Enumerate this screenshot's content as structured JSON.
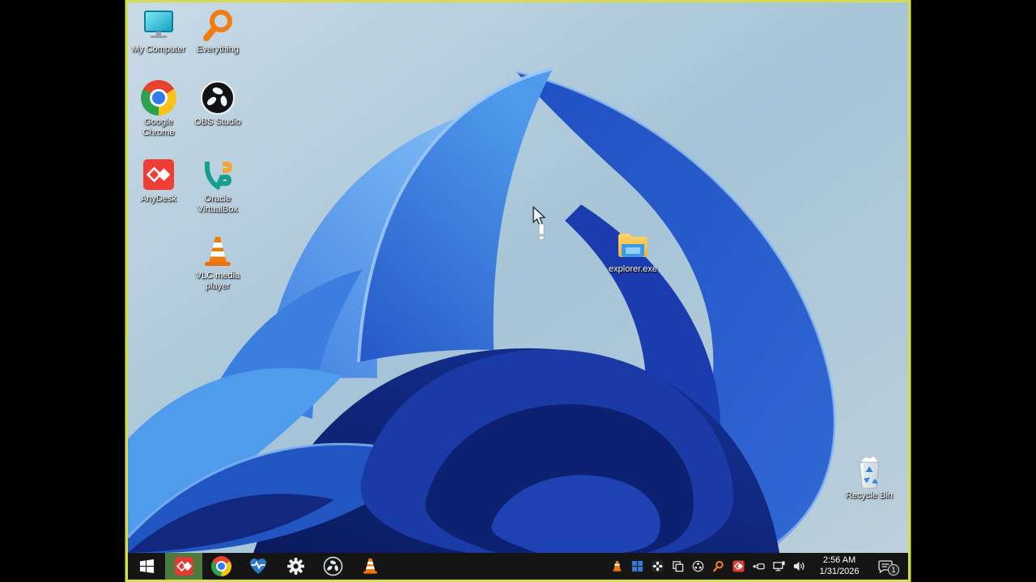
{
  "desktop": {
    "icons": [
      {
        "id": "my-computer",
        "label": "My Computer"
      },
      {
        "id": "everything",
        "label": "Everything"
      },
      {
        "id": "google-chrome",
        "label": "Google Chrome"
      },
      {
        "id": "obs-studio",
        "label": "OBS Studio"
      },
      {
        "id": "anydesk",
        "label": "AnyDesk"
      },
      {
        "id": "oracle-virtualbox",
        "label": "Oracle VirtualBox"
      },
      {
        "id": "vlc-media-player",
        "label": "VLC media player"
      },
      {
        "id": "explorer-exe",
        "label": "explorer.exe"
      },
      {
        "id": "recycle-bin",
        "label": "Recycle Bin"
      }
    ]
  },
  "taskbar": {
    "buttons": [
      "start",
      "anydesk",
      "google-chrome",
      "health-pulse",
      "settings",
      "obs-studio",
      "vlc"
    ],
    "active_button": "anydesk",
    "tray": {
      "icons": [
        "vlc",
        "apps-grid",
        "pinwheel",
        "clipboard",
        "obs-studio",
        "everything-search",
        "anydesk",
        "safely-remove-hardware",
        "ethernet-network",
        "volume"
      ],
      "clock": {
        "time": "2:56 AM",
        "date": "1/31/2026"
      },
      "notifications": {
        "count": "1"
      }
    }
  },
  "colors": {
    "frame_border": "#d6db55",
    "taskbar_bg": "#151515",
    "active_task_highlight": "#4d7a40",
    "wallpaper_sky": "#aac6d8",
    "bloom_dark": "#091a5e",
    "bloom_bright": "#4f9aec"
  }
}
